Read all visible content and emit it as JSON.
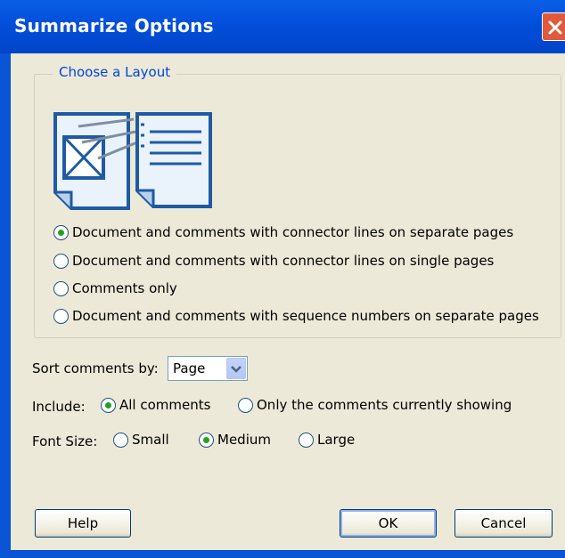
{
  "window": {
    "title": "Summarize Options",
    "accent_color": "#0a54d6",
    "close_icon": "close-icon"
  },
  "layout_group": {
    "legend": "Choose a Layout",
    "icons": [
      "document-with-connector-lines-icon",
      "comments-list-page-icon"
    ],
    "options": [
      {
        "label": "Document and comments with connector lines on separate pages",
        "selected": true
      },
      {
        "label": "Document and comments with connector lines on single pages",
        "selected": false
      },
      {
        "label": "Comments only",
        "selected": false
      },
      {
        "label": "Document and comments with sequence numbers on separate pages",
        "selected": false
      }
    ]
  },
  "sort": {
    "label": "Sort comments by:",
    "value": "Page"
  },
  "include": {
    "label": "Include:",
    "options": [
      {
        "label": "All comments",
        "selected": true
      },
      {
        "label": "Only the comments currently showing",
        "selected": false
      }
    ]
  },
  "font_size": {
    "label": "Font Size:",
    "options": [
      {
        "label": "Small",
        "selected": false
      },
      {
        "label": "Medium",
        "selected": true
      },
      {
        "label": "Large",
        "selected": false
      }
    ]
  },
  "buttons": {
    "help": "Help",
    "ok": "OK",
    "cancel": "Cancel"
  }
}
